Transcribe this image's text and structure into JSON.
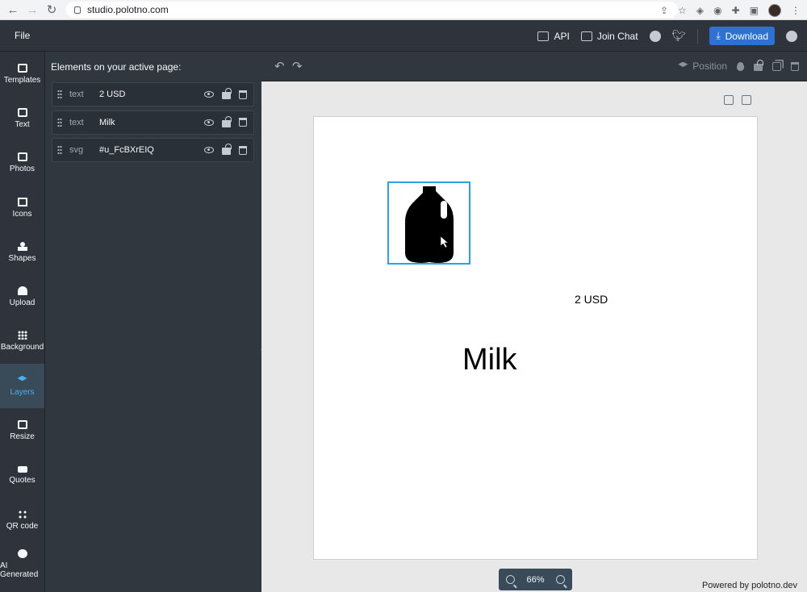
{
  "browser": {
    "url": "studio.polotno.com"
  },
  "topbar": {
    "file_label": "File",
    "api_label": "API",
    "chat_label": "Join Chat",
    "download_label": "Download"
  },
  "rail": {
    "items": [
      {
        "label": "Templates",
        "icon": "templates-icon"
      },
      {
        "label": "Text",
        "icon": "text-icon"
      },
      {
        "label": "Photos",
        "icon": "photos-icon"
      },
      {
        "label": "Icons",
        "icon": "icons-icon"
      },
      {
        "label": "Shapes",
        "icon": "shapes-icon"
      },
      {
        "label": "Upload",
        "icon": "upload-icon"
      },
      {
        "label": "Background",
        "icon": "background-icon"
      },
      {
        "label": "Layers",
        "icon": "layers-icon",
        "active": true
      },
      {
        "label": "Resize",
        "icon": "resize-icon"
      },
      {
        "label": "Quotes",
        "icon": "quotes-icon"
      },
      {
        "label": "QR code",
        "icon": "qr-code-icon"
      },
      {
        "label": "AI Generated",
        "icon": "ai-icon"
      }
    ]
  },
  "panel": {
    "title": "Elements on your active page:",
    "layers": [
      {
        "type": "text",
        "name": "2 USD"
      },
      {
        "type": "text",
        "name": "Milk"
      },
      {
        "type": "svg",
        "name": "#u_FcBXrEIQ"
      }
    ]
  },
  "toolbar": {
    "position_label": "Position"
  },
  "canvas": {
    "price": "2 USD",
    "title": "Milk"
  },
  "zoom": {
    "value": "66%"
  },
  "footer": {
    "powered": "Powered by polotno.dev"
  },
  "colors": {
    "accent": "#2d72d2",
    "selection": "#2ea2e6",
    "panel": "#30373f",
    "active_tab": "#48aff0"
  }
}
